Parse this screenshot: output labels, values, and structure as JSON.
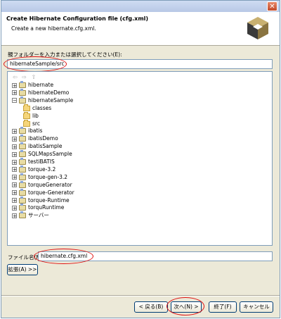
{
  "dialog": {
    "close_glyph": "✕"
  },
  "banner": {
    "title": "Create Hibernate Configuration file (cfg.xml)",
    "subtitle": "Create a new hibernate.cfg.xml."
  },
  "folder": {
    "label": "親フォルダーを入力または選択してください(E):",
    "value": "hibernateSample/src"
  },
  "tree": {
    "toolbar_icons": [
      "back-icon",
      "forward-icon",
      "up-icon"
    ],
    "items": [
      {
        "label": "hibernate",
        "type": "project",
        "expander": "+",
        "level": 0
      },
      {
        "label": "hibernateDemo",
        "type": "project",
        "expander": "+",
        "level": 0
      },
      {
        "label": "hibernateSample",
        "type": "project",
        "expander": "−",
        "level": 0
      },
      {
        "label": "classes",
        "type": "folder",
        "expander": "",
        "level": 1
      },
      {
        "label": "lib",
        "type": "folder",
        "expander": "",
        "level": 1
      },
      {
        "label": "src",
        "type": "folder",
        "expander": "",
        "level": 1
      },
      {
        "label": "ibatis",
        "type": "project",
        "expander": "+",
        "level": 0
      },
      {
        "label": "ibatisDemo",
        "type": "project",
        "expander": "+",
        "level": 0
      },
      {
        "label": "ibatisSample",
        "type": "project",
        "expander": "+",
        "level": 0
      },
      {
        "label": "SQLMapsSample",
        "type": "project",
        "expander": "+",
        "level": 0
      },
      {
        "label": "testiBATIS",
        "type": "project",
        "expander": "+",
        "level": 0
      },
      {
        "label": "torque-3.2",
        "type": "project",
        "expander": "+",
        "level": 0
      },
      {
        "label": "torque-gen-3.2",
        "type": "project",
        "expander": "+",
        "level": 0
      },
      {
        "label": "torqueGenerator",
        "type": "project",
        "expander": "+",
        "level": 0
      },
      {
        "label": "torque-Generator",
        "type": "project",
        "expander": "+",
        "level": 0
      },
      {
        "label": "torque-Runtime",
        "type": "project",
        "expander": "+",
        "level": 0
      },
      {
        "label": "torquRuntime",
        "type": "project",
        "expander": "+",
        "level": 0
      },
      {
        "label": "サーバー",
        "type": "project",
        "expander": "+",
        "level": 0
      }
    ]
  },
  "file": {
    "label": "ファイル名(M):",
    "value": "hibernate.cfg.xml"
  },
  "buttons": {
    "advanced": "拡張(A) >>",
    "back": "< 戻る(B)",
    "next": "次へ(N) >",
    "finish": "終了(F)",
    "cancel": "キャンセル"
  },
  "colors": {
    "highlight_oval": "#e01010",
    "title_bar": "#b8c8e6",
    "close_button": "#c24a2a"
  }
}
